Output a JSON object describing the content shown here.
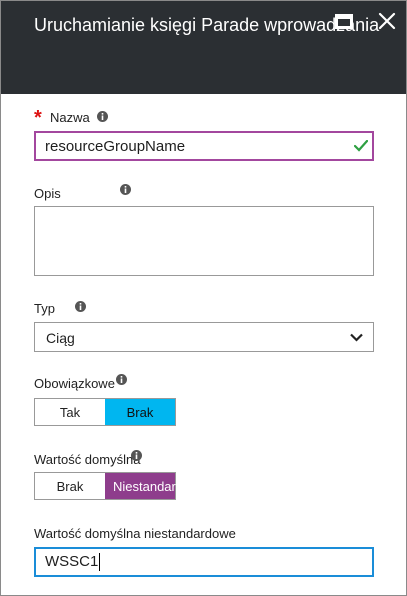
{
  "header": {
    "title": "Uruchamianie księgi Parade wprowadzania",
    "minimize_icon": "minimize-icon",
    "close_icon": "close-icon"
  },
  "form": {
    "name": {
      "label": "Nazwa",
      "required": "*",
      "value": "resourceGroupName",
      "valid_icon": "check-icon"
    },
    "description": {
      "label": "Opis",
      "value": ""
    },
    "type": {
      "label": "Typ",
      "value": "Ciąg",
      "icon": "chevron-down-icon"
    },
    "required": {
      "label": "Obowiązkowe",
      "options": [
        "Tak",
        "Brak"
      ],
      "selected": "Brak"
    },
    "default": {
      "label": "Wartość domyślna",
      "options": [
        "Brak",
        "Niestandardowe"
      ],
      "selected": "Niestandardowe"
    },
    "custom_default": {
      "label": "Wartość domyślna niestandardowe",
      "value": "WSSC1"
    }
  },
  "colors": {
    "header_bg": "#2b2f33",
    "valid_border": "#a3479e",
    "selected_blue": "#00b6f0",
    "selected_purple": "#8e3d8c",
    "focus_border": "#1a8dd8",
    "required_star": "#dd1111"
  }
}
